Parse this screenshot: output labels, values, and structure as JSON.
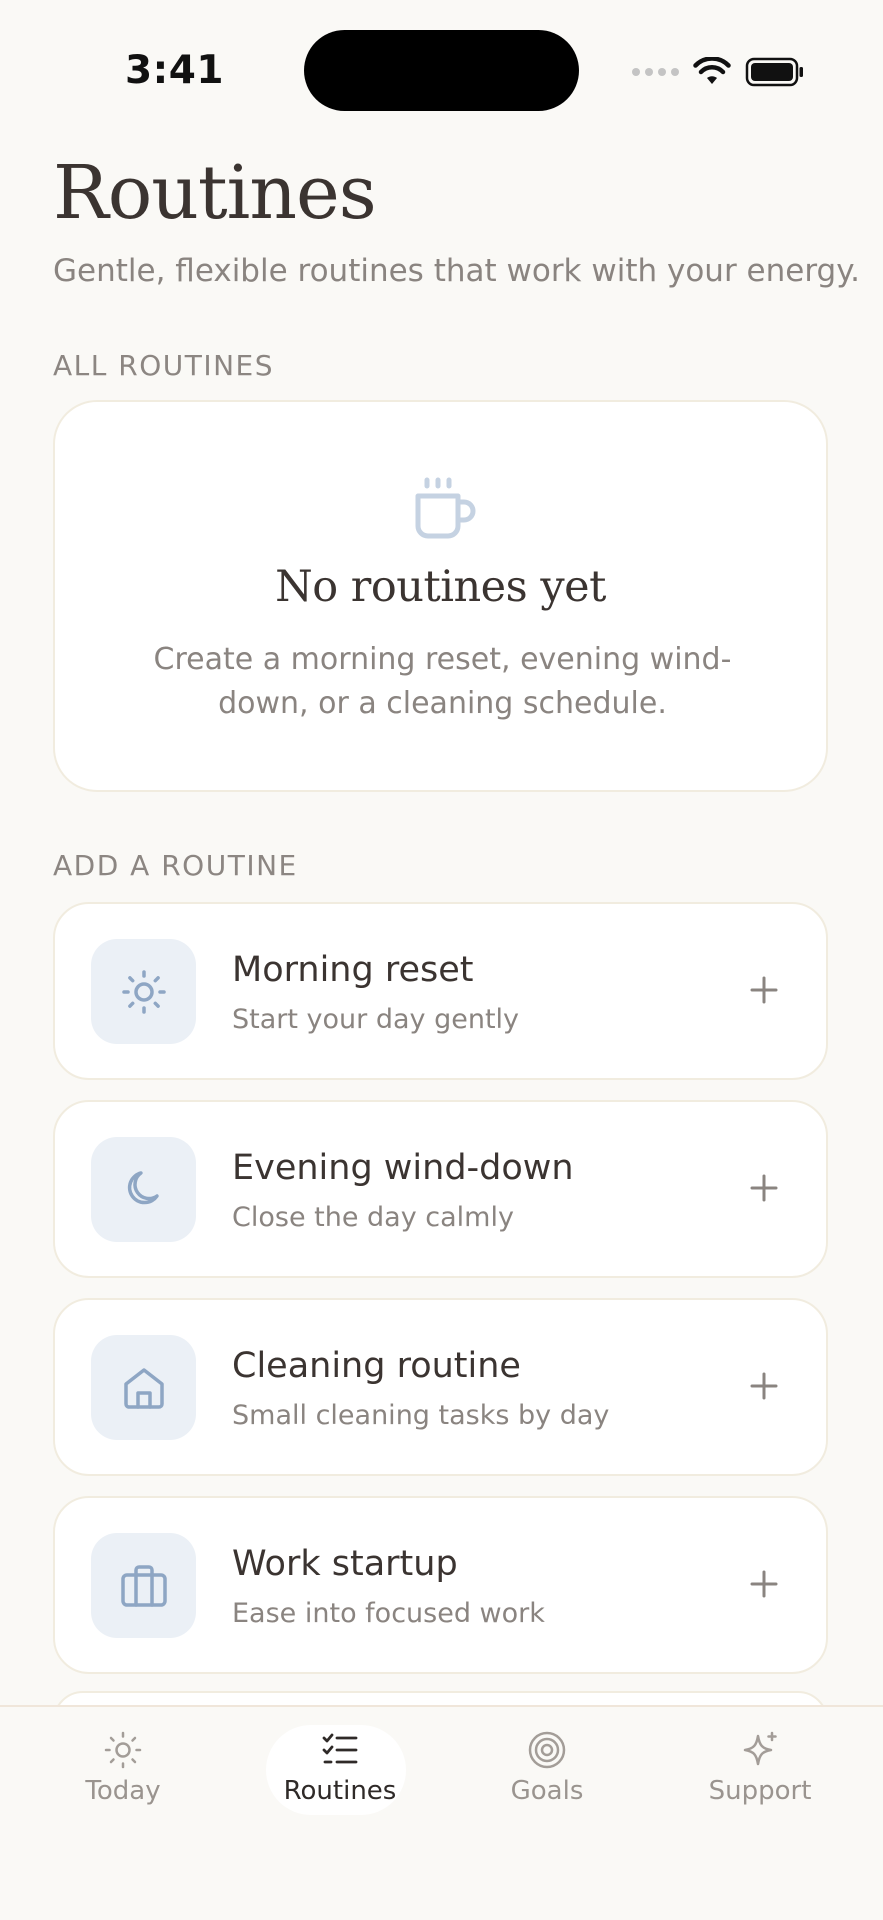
{
  "status_bar": {
    "time": "3:41"
  },
  "header": {
    "title": "Routines",
    "subtitle": "Gentle, flexible routines that work with your energy."
  },
  "all_routines": {
    "section_label": "ALL ROUTINES",
    "empty_state": {
      "icon": "cup-icon",
      "title": "No routines yet",
      "text": "Create a morning reset, evening wind-down, or a cleaning schedule."
    }
  },
  "add_routine": {
    "section_label": "ADD A ROUTINE",
    "items": [
      {
        "name": "Morning reset",
        "description": "Start your day gently",
        "icon": "sun-icon"
      },
      {
        "name": "Evening wind-down",
        "description": "Close the day calmly",
        "icon": "moon-icon"
      },
      {
        "name": "Cleaning routine",
        "description": "Small cleaning tasks by day",
        "icon": "house-icon"
      },
      {
        "name": "Work startup",
        "description": "Ease into focused work",
        "icon": "briefcase-icon"
      }
    ]
  },
  "tab_bar": {
    "active": "Routines",
    "tabs": [
      {
        "label": "Today",
        "icon": "sun-icon"
      },
      {
        "label": "Routines",
        "icon": "checklist-icon"
      },
      {
        "label": "Goals",
        "icon": "target-icon"
      },
      {
        "label": "Support",
        "icon": "sparkle-icon"
      }
    ]
  },
  "colors": {
    "background": "#faf9f6",
    "card": "#ffffff",
    "card_border": "#f1ecdf",
    "icon_tint": "#8ea6c4",
    "icon_bg": "#ebf0f6",
    "text_primary": "#3b3431",
    "text_secondary": "#8a8480"
  }
}
